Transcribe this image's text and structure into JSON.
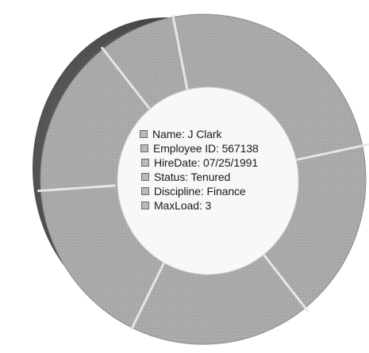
{
  "colors": {
    "ring_fill": "#a8a8a8",
    "ring_shadow_dark": "#3a3a3a",
    "ring_shadow_mid": "#6e6e6e",
    "divider": "#e4e4e4",
    "hole": "#f7f7f7"
  },
  "ring": {
    "segment_count": 6
  },
  "details": {
    "name": "Name: J Clark",
    "employee_id": "Employee ID: 567138",
    "hire_date": "HireDate: 07/25/1991",
    "status": "Status: Tenured",
    "discipline": "Discipline: Finance",
    "max_load": "MaxLoad: 3"
  },
  "icons": {
    "row_icon": "square-icon"
  }
}
